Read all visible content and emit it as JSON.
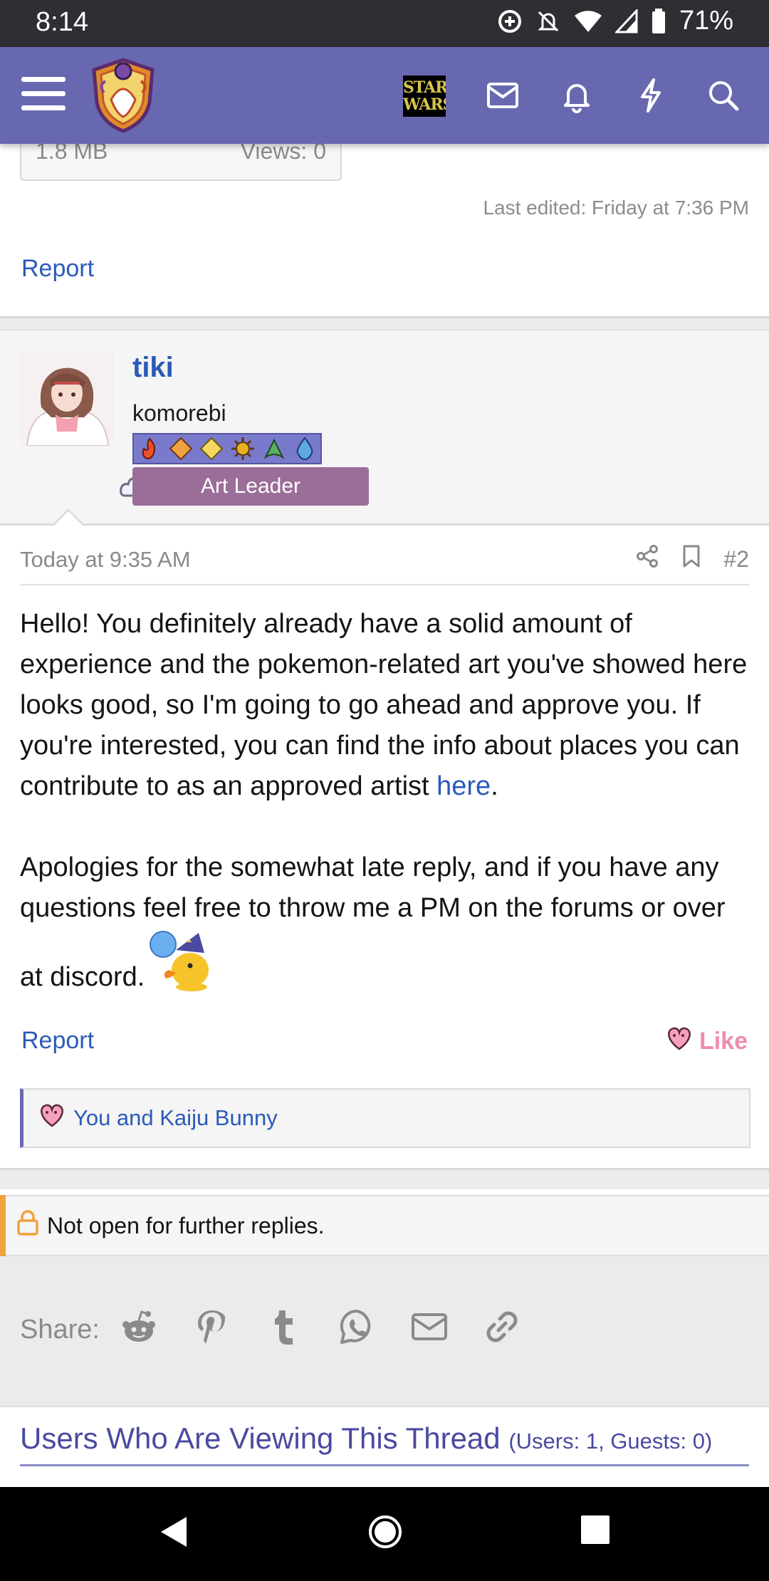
{
  "status_bar": {
    "time": "8:14",
    "battery": "71%"
  },
  "header": {
    "logo_text": "STAR WARS",
    "icons": [
      "menu-icon",
      "site-logo",
      "star-wars-badge",
      "inbox-icon",
      "bell-icon",
      "bolt-icon",
      "search-icon"
    ]
  },
  "attachment": {
    "size": "1.8 MB",
    "views": "Views: 0"
  },
  "previous_post": {
    "last_edited": "Last edited: Friday at 7:36 PM",
    "report_label": "Report"
  },
  "post": {
    "username": "tiki",
    "user_title": "komorebi",
    "banner": "Art Leader",
    "date": "Today at 9:35 AM",
    "number": "#2",
    "body_p1_text": "Hello! You definitely already have a solid amount of experience and the pokemon-related art you've showed here looks good, so I'm going to go ahead and approve you. If you're interested, you can find the info about places you can contribute to as an approved artist ",
    "body_p1_link": "here",
    "body_p1_end": ".",
    "body_p2": "Apologies for the somewhat late reply, and if you have any questions feel free to throw me a PM on the forums or over at discord.",
    "report_label": "Report",
    "like_label": "Like",
    "likes_text": "You and Kaiju Bunny"
  },
  "thread": {
    "locked_text": "Not open for further replies.",
    "share_label": "Share:",
    "share_icons": [
      "reddit-icon",
      "pinterest-icon",
      "tumblr-icon",
      "whatsapp-icon",
      "email-icon",
      "link-icon"
    ],
    "viewing_title": "Users Who Are Viewing This Thread",
    "viewing_counts": "(Users: 1, Guests: 0)"
  },
  "colors": {
    "header": "#6868b0",
    "link": "#2b5ab8",
    "like": "#ef8cae",
    "banner": "#9a6e98",
    "locked_accent": "#f0a23c"
  }
}
